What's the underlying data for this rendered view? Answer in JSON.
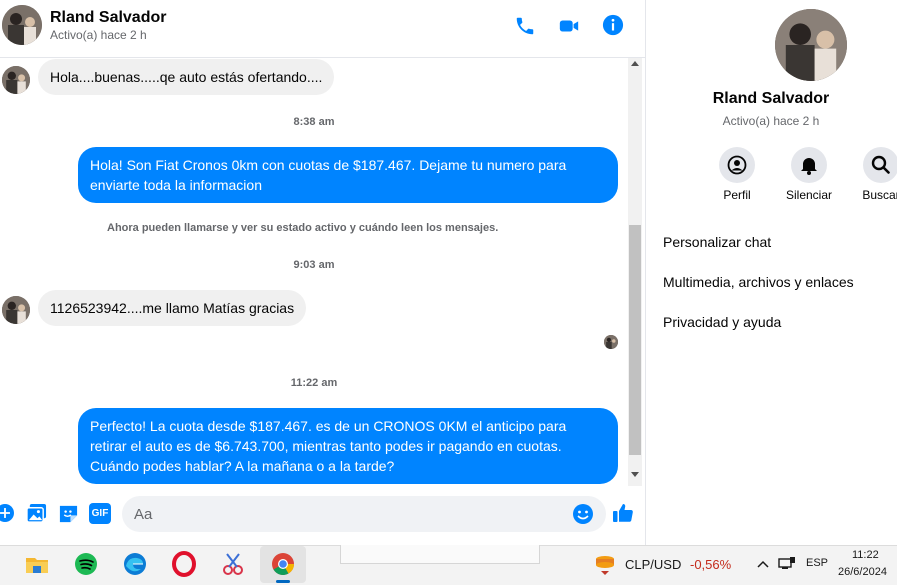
{
  "contact": {
    "name": "Rland Salvador",
    "status": "Activo(a) hace 2 h"
  },
  "messages": {
    "m1": "Hola....buenas.....qe auto estás ofertando....",
    "ts1": "8:38 am",
    "m2": "Hola! Son Fiat Cronos 0km con cuotas de $187.467. Dejame tu numero para enviarte toda la informacion",
    "sys": "Ahora pueden llamarse y ver su estado activo y cuándo leen los mensajes.",
    "ts2": "9:03 am",
    "m3": "1126523942....me llamo Matías gracias",
    "ts3": "11:22 am",
    "m4": "Perfecto! La cuota desde $187.467. es de un CRONOS 0KM el anticipo para retirar el auto es de $6.743.700, mientras tanto podes ir pagando en cuotas. Cuándo podes hablar? A la mañana o a la tarde?"
  },
  "composer": {
    "placeholder": "Aa",
    "gif_label": "GIF"
  },
  "panel": {
    "actions": [
      "Perfil",
      "Silenciar",
      "Buscar"
    ],
    "menu": [
      "Personalizar chat",
      "Multimedia, archivos y enlaces",
      "Privacidad y ayuda"
    ]
  },
  "taskbar": {
    "currency_pair": "CLP/USD",
    "currency_change": "-0,56%",
    "lang": "ESP",
    "time": "11:22",
    "date": "26/6/2024"
  },
  "colors": {
    "accent": "#0084ff",
    "negative": "#c42b1c"
  },
  "icons": [
    "phone-icon",
    "video-icon",
    "info-icon",
    "plus-icon",
    "image-icon",
    "sticker-icon",
    "gif-icon",
    "emoji-icon",
    "like-icon",
    "person-icon",
    "bell-icon",
    "search-icon",
    "file-explorer-icon",
    "spotify-icon",
    "edge-icon",
    "opera-icon",
    "snipping-icon",
    "chrome-icon",
    "stock-icon",
    "chevron-up-icon",
    "network-icon"
  ]
}
